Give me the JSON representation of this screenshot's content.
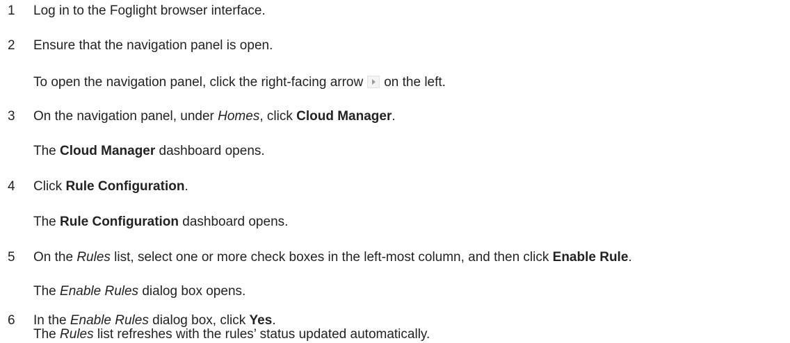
{
  "steps": [
    {
      "number": "1",
      "text": "Log in to the Foglight browser interface."
    },
    {
      "number": "2",
      "text": "Ensure that the navigation panel is open.",
      "note_before": "To open the navigation panel, click the right-facing arrow",
      "note_after": "on the left.",
      "note_icon": "right-arrow-icon"
    },
    {
      "number": "3",
      "text_before": "On the navigation panel, under ",
      "text_italic": "Homes",
      "text_middle": ", click ",
      "text_bold": "Cloud Manager",
      "text_after": ".",
      "note_before": "The ",
      "note_bold": "Cloud Manager",
      "note_after": " dashboard opens."
    },
    {
      "number": "4",
      "text_before": "Click ",
      "text_bold": "Rule Configuration",
      "text_after": ".",
      "note_before": "The ",
      "note_bold": "Rule Configuration",
      "note_after": " dashboard opens."
    },
    {
      "number": "5",
      "text_before": "On the ",
      "text_italic": "Rules",
      "text_middle": " list, select one or more check boxes in the left-most column, and then click ",
      "text_bold": "Enable Rule",
      "text_after": ".",
      "note_before": "The ",
      "note_italic": "Enable Rules",
      "note_after": " dialog box opens."
    },
    {
      "number": "6",
      "text_before": "In the ",
      "text_italic": "Enable Rules",
      "text_middle": " dialog box, click ",
      "text_bold": "Yes",
      "text_after": ".",
      "note_before": "The ",
      "note_italic": "Rules",
      "note_after": " list refreshes with the rules’ status updated automatically."
    }
  ]
}
